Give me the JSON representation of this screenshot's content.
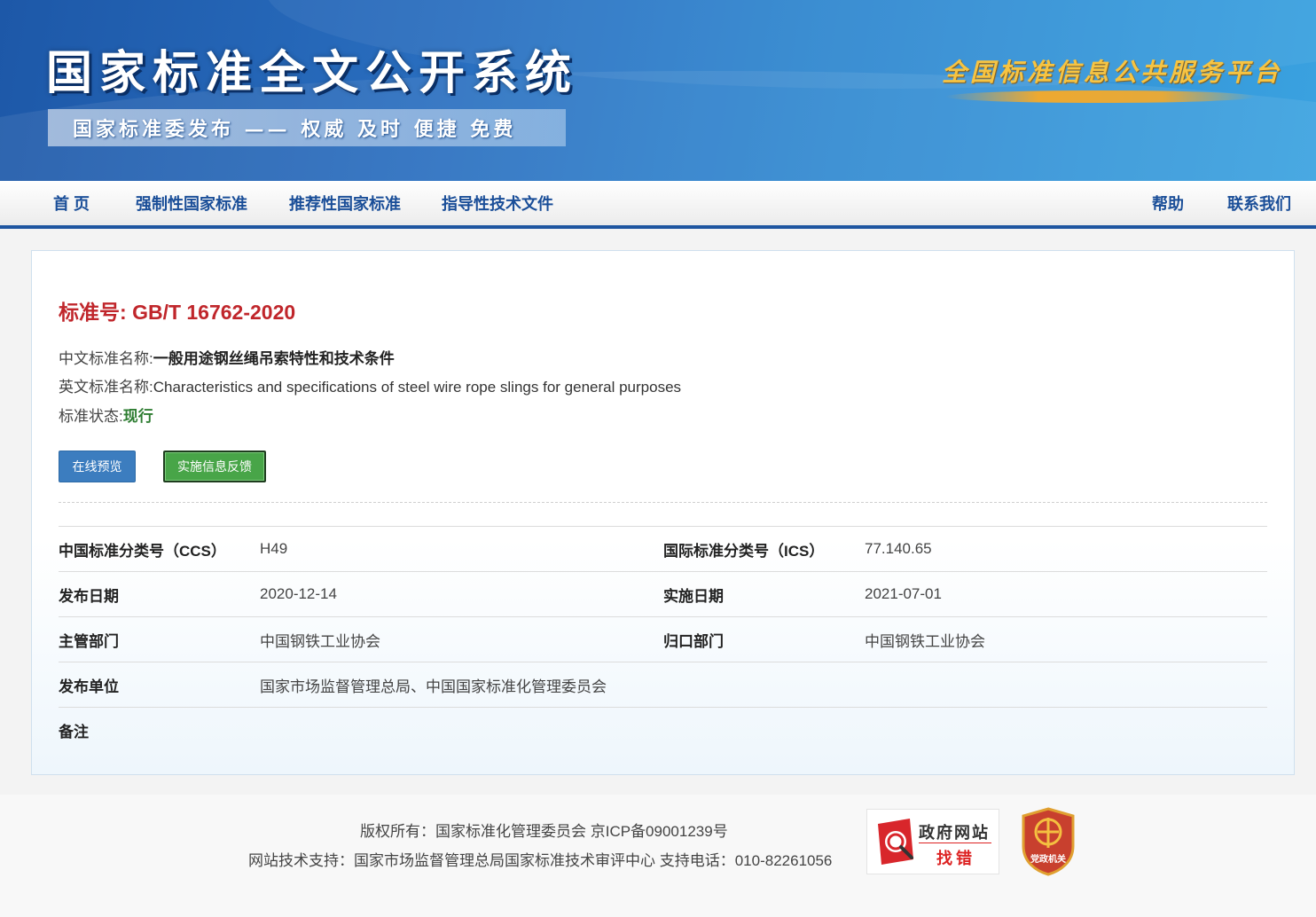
{
  "header": {
    "site_title": "国家标准全文公开系统",
    "slogan": "国家标准委发布 —— 权威 及时 便捷 免费",
    "platform_name": "全国标准信息公共服务平台"
  },
  "nav": {
    "left": [
      "首 页",
      "强制性国家标准",
      "推荐性国家标准",
      "指导性技术文件"
    ],
    "right": [
      "帮助",
      "联系我们"
    ]
  },
  "standard": {
    "number_label": "标准号:",
    "number": "GB/T 16762-2020",
    "cn_name_label": "中文标准名称:",
    "cn_name": "一般用途钢丝绳吊索特性和技术条件",
    "en_name_label": "英文标准名称:",
    "en_name": "Characteristics and specifications of steel wire rope slings for general purposes",
    "status_label": "标准状态:",
    "status": "现行"
  },
  "buttons": {
    "preview": "在线预览",
    "feedback": "实施信息反馈"
  },
  "details": {
    "ccs_label": "中国标准分类号（CCS）",
    "ccs": "H49",
    "ics_label": "国际标准分类号（ICS）",
    "ics": "77.140.65",
    "publish_date_label": "发布日期",
    "publish_date": "2020-12-14",
    "impl_date_label": "实施日期",
    "impl_date": "2021-07-01",
    "competent_label": "主管部门",
    "competent": "中国钢铁工业协会",
    "centralized_label": "归口部门",
    "centralized": "中国钢铁工业协会",
    "publisher_label": "发布单位",
    "publisher": "国家市场监督管理总局、中国国家标准化管理委员会",
    "remark_label": "备注",
    "remark": ""
  },
  "footer": {
    "copyright": "版权所有：国家标准化管理委员会 京ICP备09001239号",
    "support": "网站技术支持：国家市场监督管理总局国家标准技术审评中心 支持电话：010-82261056",
    "gov_badge_line1": "政府网站",
    "gov_badge_line2": "找错",
    "party_badge": "党政机关"
  },
  "colors": {
    "nav_text": "#1a4e98",
    "std_number": "#c0262b",
    "status_green": "#2e7d32",
    "preview_button": "#3c7dbf",
    "feedback_button": "#48a548"
  }
}
